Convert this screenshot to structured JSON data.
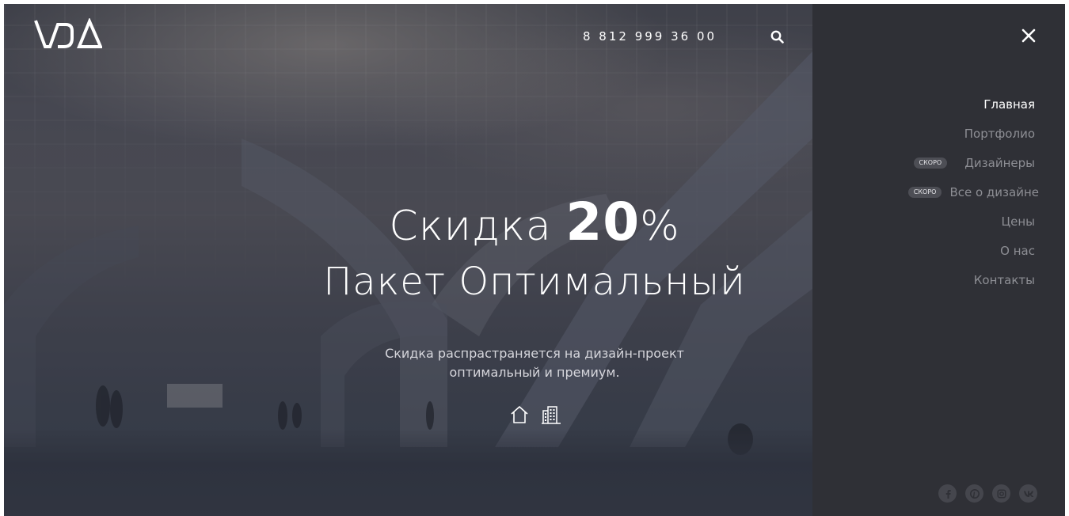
{
  "header": {
    "logo_text": "VDA",
    "phone": "8 812 999 36 00",
    "search_icon": "search-icon"
  },
  "hero": {
    "headline_word": "Скидка",
    "headline_number": "20",
    "headline_percent": "%",
    "headline_line2": "Пакет Оптимальный",
    "subtext_line1": "Скидка распрастраняется на дизайн-проект",
    "subtext_line2": "оптимальный и премиум.",
    "icons": [
      "house-icon",
      "building-icon"
    ]
  },
  "sidebar": {
    "close_icon": "close-icon",
    "menu": [
      {
        "label": "Главная",
        "active": true,
        "badge": ""
      },
      {
        "label": "Портфолио",
        "active": false,
        "badge": ""
      },
      {
        "label": "Дизайнеры",
        "active": false,
        "badge": "скоро"
      },
      {
        "label": "Все о дизайне",
        "active": false,
        "badge": "скоро"
      },
      {
        "label": "Цены",
        "active": false,
        "badge": ""
      },
      {
        "label": "О нас",
        "active": false,
        "badge": ""
      },
      {
        "label": "Контакты",
        "active": false,
        "badge": ""
      }
    ],
    "socials": [
      {
        "icon": "facebook-icon",
        "glyph": "f"
      },
      {
        "icon": "pinterest-icon",
        "glyph": "p"
      },
      {
        "icon": "instagram-icon",
        "glyph": ""
      },
      {
        "icon": "vk-icon",
        "glyph": "vk"
      }
    ]
  },
  "colors": {
    "sidebar_bg": "#2f3036",
    "menu_active": "#ffffff",
    "menu_inactive": "#8d8e94",
    "badge_bg": "#4d4e55"
  }
}
